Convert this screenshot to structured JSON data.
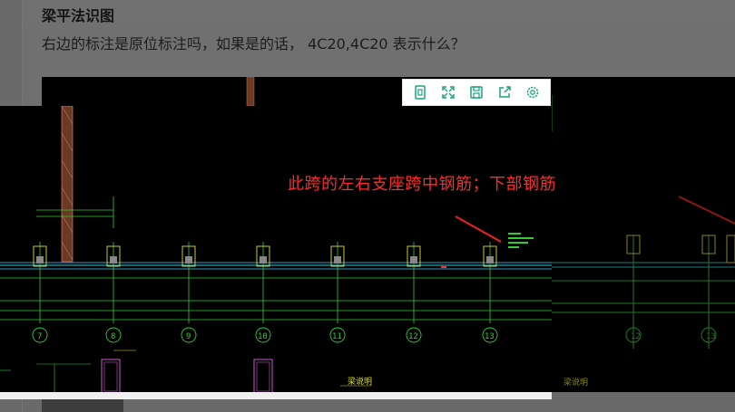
{
  "question": {
    "title": "梁平法识图",
    "body": "右边的标注是原位标注吗，如果是的话，  4C20,4C20    表示什么？"
  },
  "image_toolbar": {
    "buttons": [
      {
        "name": "original-size-icon"
      },
      {
        "name": "fullscreen-icon"
      },
      {
        "name": "save-icon"
      },
      {
        "name": "share-icon"
      },
      {
        "name": "settings-icon"
      }
    ],
    "accent": "#1aa37a"
  },
  "drawing": {
    "annotation": "此跨的左右支座跨中钢筋；下部钢筋",
    "annotation_color": "#ff2b2b",
    "axis_labels": [
      "7",
      "8",
      "9",
      "10",
      "11",
      "12",
      "13"
    ],
    "axis_labels_back": [
      "12",
      "13"
    ],
    "footer_label": "梁说明",
    "footer_label_back": "梁说明"
  }
}
